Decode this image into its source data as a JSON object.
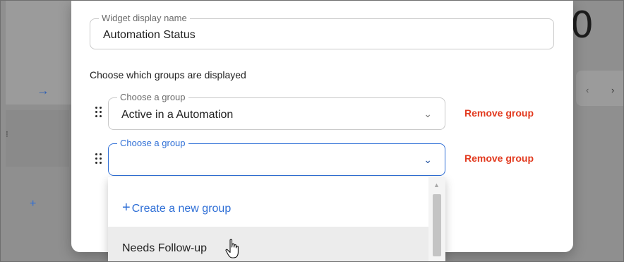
{
  "background": {
    "arrow_icon": "arrow-right-icon",
    "big_number": "0",
    "nav_prev": "‹",
    "nav_next": "›"
  },
  "modal": {
    "name_field": {
      "legend": "Widget display name",
      "value": "Automation Status"
    },
    "groups_label": "Choose which groups are displayed",
    "groups": [
      {
        "legend": "Choose a group",
        "value": "Active in a Automation",
        "remove_label": "Remove group"
      },
      {
        "legend": "Choose a group",
        "value": "",
        "remove_label": "Remove group"
      }
    ],
    "add_group_symbol": "+"
  },
  "dropdown": {
    "create_symbol": "+",
    "create_label": "Create a new group",
    "options": [
      "Needs Follow-up"
    ]
  },
  "colors": {
    "accent": "#2f6fd6",
    "danger": "#e23a1f",
    "overlay": "#8f8f8f"
  }
}
